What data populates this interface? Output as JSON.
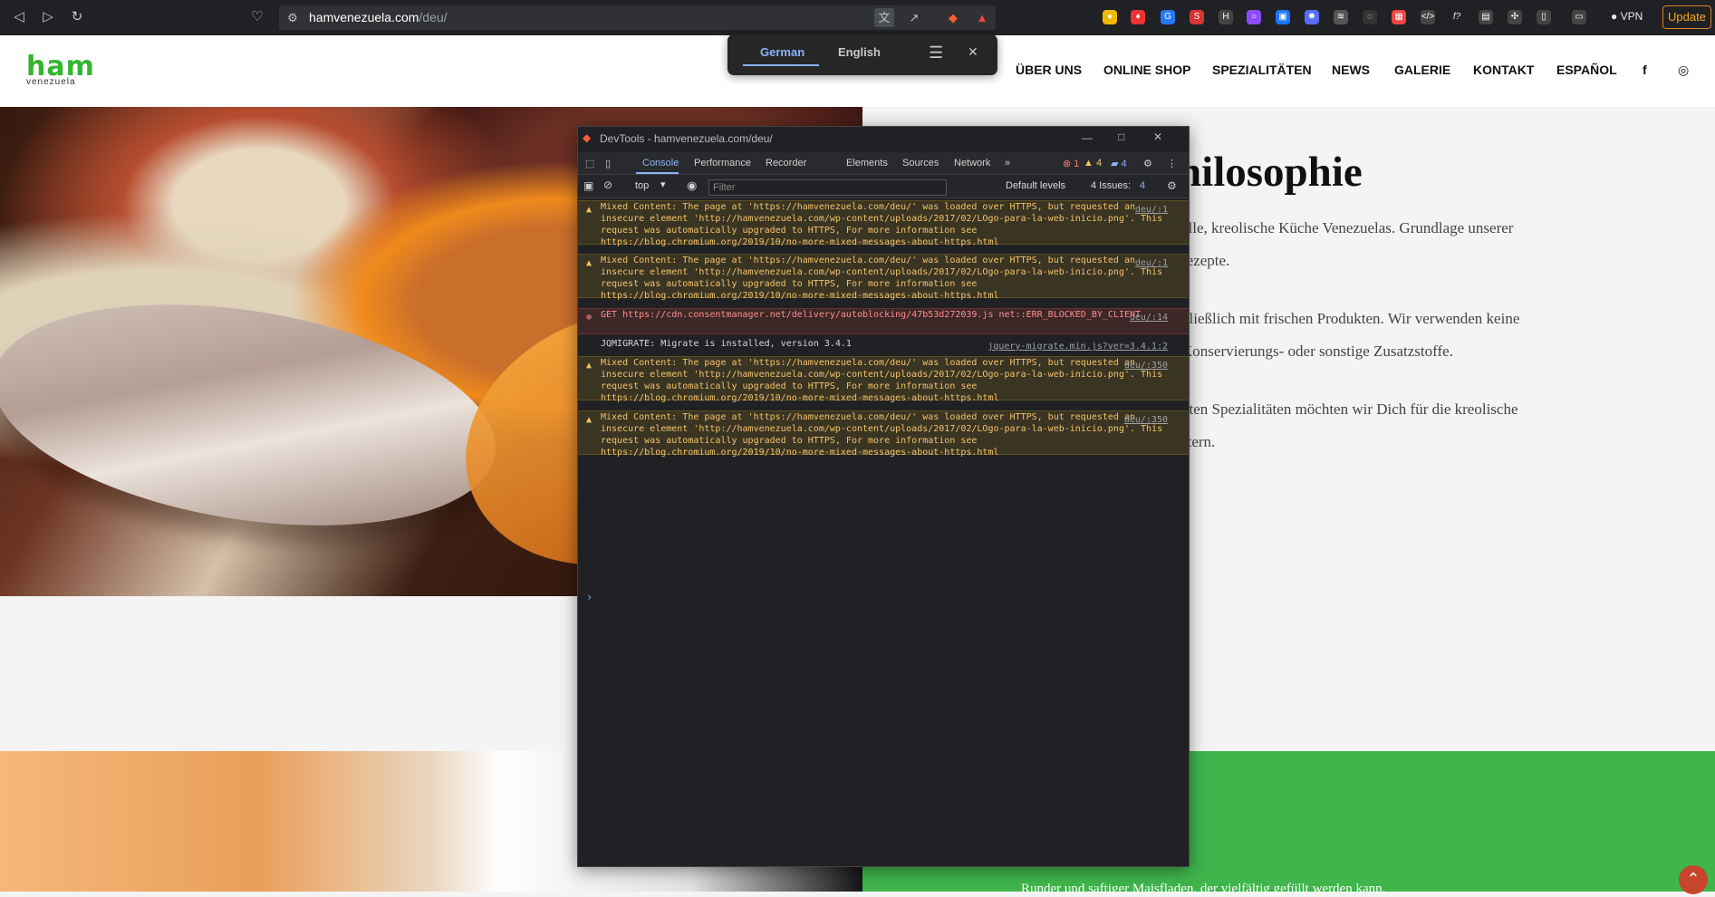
{
  "browser": {
    "url_host": "hamvenezuela.com",
    "url_path": "/deu/",
    "update": "Update",
    "vpn": "VPN"
  },
  "translate": {
    "lang1": "German",
    "lang2": "English",
    "close": "✕"
  },
  "site": {
    "logo": "ham",
    "logo_sub": "venezuela",
    "nav": [
      "ÜBER UNS",
      "ONLINE SHOP",
      "SPEZIALITÄTEN",
      "NEWS",
      "GALERIE",
      "KONTAKT",
      "ESPAÑOL"
    ],
    "heading": "hilosophie",
    "paragraphs": [
      "elle, kreolische Küche Venezuelas. Grundlage unserer",
      "rezepte.",
      "hließlich mit frischen Produkten. Wir verwenden keine",
      "Konservierungs- oder sonstige Zusatzstoffe.",
      "nten Spezialitäten möchten wir Dich für die kreolische",
      "stern."
    ],
    "lower_text": "Runder und saftiger Maisfladen, der vielfältig gefüllt werden kann."
  },
  "devtools": {
    "title": "DevTools - hamvenezuela.com/deu/",
    "tabs": [
      "Console",
      "Performance",
      "Recorder",
      "Elements",
      "Sources",
      "Network"
    ],
    "error_count": "1",
    "warning_count": "4",
    "issue_count": "4",
    "context": "top",
    "filter_placeholder": "Filter",
    "levels": "Default levels",
    "issues": "4 Issues:",
    "messages": [
      {
        "type": "warn",
        "text": "Mixed Content: The page at 'https://hamvenezuela.com/deu/' was loaded over HTTPS, but requested an insecure element 'http://hamvenezuela.com/wp-content/uploads/2017/02/LOgo-para-la-web-inicio.png'. This request was automatically upgraded to HTTPS, For more information see https://blog.chromium.org/2019/10/no-more-mixed-messages-about-https.html",
        "source": "deu/:1"
      },
      {
        "type": "warn",
        "text": "Mixed Content: The page at 'https://hamvenezuela.com/deu/' was loaded over HTTPS, but requested an insecure element 'http://hamvenezuela.com/wp-content/uploads/2017/02/LOgo-para-la-web-inicio.png'. This request was automatically upgraded to HTTPS, For more information see https://blog.chromium.org/2019/10/no-more-mixed-messages-about-https.html",
        "source": "deu/:1"
      },
      {
        "type": "err",
        "text": "GET https://cdn.consentmanager.net/delivery/autoblocking/47b53d272039.js net::ERR_BLOCKED_BY_CLIENT",
        "source": "deu/:14"
      },
      {
        "type": "info",
        "text": "JQMIGRATE: Migrate is installed, version 3.4.1",
        "source": "jquery-migrate.min.js?ver=3.4.1:2"
      },
      {
        "type": "warn",
        "text": "Mixed Content: The page at 'https://hamvenezuela.com/deu/' was loaded over HTTPS, but requested an insecure element 'http://hamvenezuela.com/wp-content/uploads/2017/02/LOgo-para-la-web-inicio.png'. This request was automatically upgraded to HTTPS, For more information see https://blog.chromium.org/2019/10/no-more-mixed-messages-about-https.html",
        "source": "deu/:350"
      },
      {
        "type": "warn",
        "text": "Mixed Content: The page at 'https://hamvenezuela.com/deu/' was loaded over HTTPS, but requested an insecure element 'http://hamvenezuela.com/wp-content/uploads/2017/02/LOgo-para-la-web-inicio.png'. This request was automatically upgraded to HTTPS, For more information see https://blog.chromium.org/2019/10/no-more-mixed-messages-about-https.html",
        "source": "deu/:350"
      }
    ]
  },
  "colors": {
    "brand": "#33b52f",
    "green": "#3fb54b",
    "warning": "#f4c36a",
    "error": "#ff8e8e"
  }
}
